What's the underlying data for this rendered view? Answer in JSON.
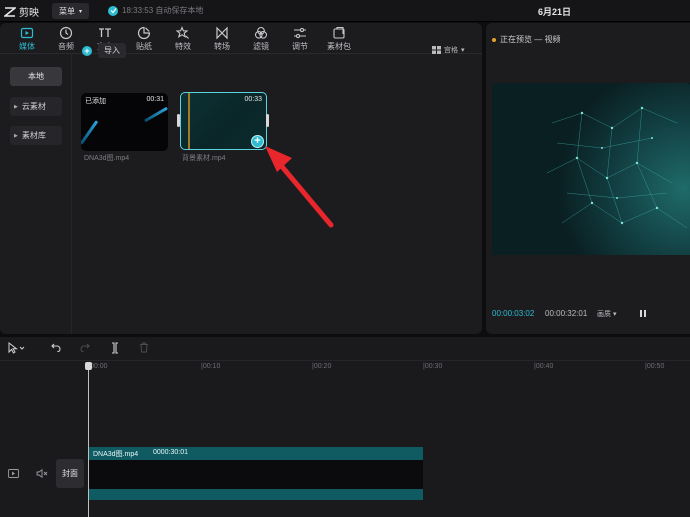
{
  "app": {
    "name": "剪映",
    "menu_label": "菜单",
    "save_status": "18:33:53 自动保存本地",
    "date": "6月21日"
  },
  "toolbar": {
    "tabs": [
      {
        "label": "媒体",
        "icon": "media-icon",
        "active": true
      },
      {
        "label": "音频",
        "icon": "audio-icon"
      },
      {
        "label": "文本",
        "icon": "text-icon"
      },
      {
        "label": "贴纸",
        "icon": "sticker-icon"
      },
      {
        "label": "特效",
        "icon": "effects-icon"
      },
      {
        "label": "转场",
        "icon": "transition-icon"
      },
      {
        "label": "滤镜",
        "icon": "filter-icon"
      },
      {
        "label": "调节",
        "icon": "adjust-icon"
      },
      {
        "label": "素材包",
        "icon": "material-pack-icon"
      }
    ]
  },
  "sidebar": {
    "items": [
      {
        "label": "本地"
      },
      {
        "label": "云素材"
      },
      {
        "label": "素材库"
      }
    ]
  },
  "media": {
    "import_label": "导入",
    "view_label": "宫格",
    "clips": [
      {
        "tag": "已添加",
        "duration": "00:31",
        "name": "DNA3d图.mp4"
      },
      {
        "tag": "",
        "duration": "00:33",
        "name": "背景素材.mp4"
      }
    ]
  },
  "preview": {
    "title": "正在预览 — 视频",
    "time_current": "00:00:03:02",
    "time_total": "00:00:32:01",
    "ratio_label": "画质"
  },
  "timeline": {
    "ticks": [
      "00:00",
      "|00:10",
      "|00:20",
      "|00:30",
      "|00:40",
      "|00:50"
    ],
    "cover_label": "封面",
    "clip": {
      "name": "DNA3d图.mp4",
      "duration": "0000:30:01"
    }
  },
  "colors": {
    "accent": "#2dbcd1",
    "arrow": "#e8262b",
    "track": "#0f5b61"
  }
}
